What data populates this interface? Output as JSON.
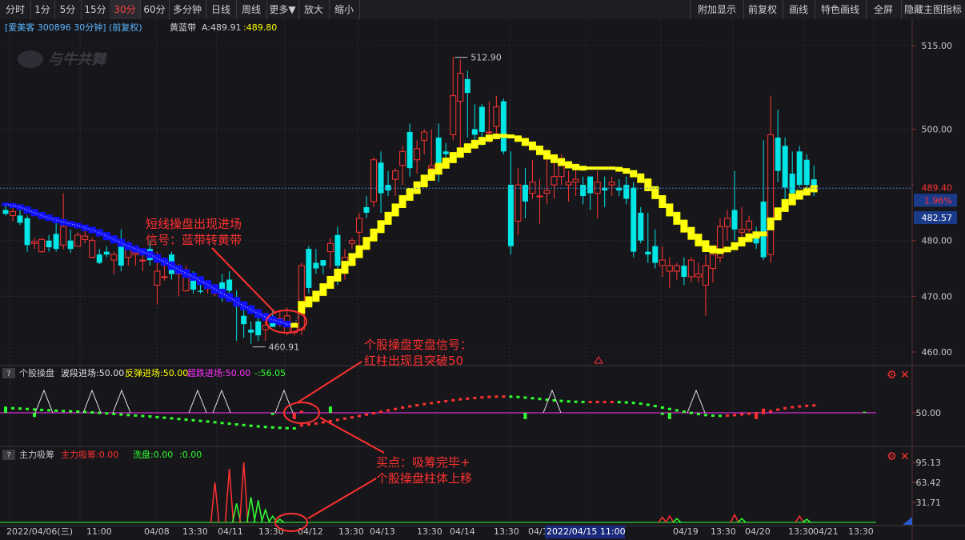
{
  "toolbar": {
    "left_buttons": [
      "分时",
      "1分",
      "5分",
      "15分",
      "30分",
      "60分",
      "多分钟",
      "日线",
      "周线",
      "更多▼",
      "放大",
      "缩小"
    ],
    "active": "30分",
    "right_buttons": [
      "附加显示",
      "前复权",
      "画线",
      "特色画线",
      "全屏",
      "隐藏主图指标"
    ]
  },
  "header": {
    "stock": "[爱美客 300896 30分钟] (前复权)",
    "indicator_name": "黄蓝带",
    "indicator_a_label": "A:489.91",
    "indicator_b_value": "489.80"
  },
  "watermark": "与牛共舞",
  "price_axis": {
    "ticks": [
      "515.00",
      "500.00",
      "490.00",
      "480.00",
      "470.00",
      "460.00"
    ],
    "last_price": "489.40",
    "change_pct": "1.96%",
    "blue_band_value": "482.57",
    "high_marker": "512.90",
    "low_marker": "460.91"
  },
  "panel2": {
    "title": "个股操盘",
    "items": [
      {
        "label": "波段进场:50.00",
        "color": "#e0e0e0"
      },
      {
        "label": "反弹进场:50.00",
        "color": "#ffff00"
      },
      {
        "label": "超跌进场:50.00",
        "color": "#ff30ff"
      },
      {
        "label": "-:56.05",
        "color": "#30ff30"
      }
    ],
    "axis_label": "50.00"
  },
  "panel3": {
    "title": "主力吸筹",
    "items": [
      {
        "label": "主力吸筹:0.00",
        "color": "#ff3030"
      },
      {
        "label": "洗盘:0.00",
        "color": "#30ff30"
      },
      {
        "label": ":0.00",
        "color": "#30ff30"
      }
    ],
    "axis_labels": [
      "95.13",
      "63.42",
      "31.71"
    ]
  },
  "time_axis": {
    "labels": [
      "2022/04/06(三)",
      "11:00",
      "04/08",
      "13:30",
      "04/11",
      "13:30",
      "04/12",
      "13:30",
      "04/13",
      "13:30",
      "04/14",
      "13:30",
      "04/1",
      "13:30",
      "04/19",
      "13:30",
      "04/20",
      "13:30",
      "04/21",
      "13:30"
    ],
    "cursor_label": "2022/04/15 11:00"
  },
  "annotations": {
    "a1_line1": "短线操盘出现进场",
    "a1_line2": "信号：蓝带转黄带",
    "a2_line1": "个股操盘变盘信号：",
    "a2_line2": "红柱出现且突破50",
    "a3_line1": "买点：吸筹完毕+",
    "a3_line2": "个股操盘柱体上移"
  },
  "chart_data": {
    "type": "candlestick",
    "title": "爱美客 300896 30分钟",
    "ylim": [
      458,
      517
    ],
    "candles_ohlc": [
      [
        485.5,
        486.5,
        484.5,
        484.8
      ],
      [
        484.5,
        486.5,
        483.5,
        485.2
      ],
      [
        484.5,
        485.5,
        482.8,
        483.2
      ],
      [
        484.0,
        484.5,
        478.0,
        479.2
      ],
      [
        479.5,
        480.5,
        478.5,
        479.8
      ],
      [
        478.0,
        480.5,
        477.8,
        480.2
      ],
      [
        480.0,
        481.0,
        478.0,
        478.8
      ],
      [
        481.2,
        483.5,
        478.0,
        478.5
      ],
      [
        479.2,
        488.5,
        478.5,
        482.5
      ],
      [
        480.0,
        482.0,
        477.8,
        478.5
      ],
      [
        479.0,
        481.5,
        479.0,
        481.0
      ],
      [
        480.2,
        481.8,
        479.5,
        480.8
      ],
      [
        477.0,
        480.5,
        476.8,
        480.0
      ],
      [
        477.5,
        478.5,
        475.8,
        476.0
      ],
      [
        478.0,
        479.0,
        477.0,
        477.5
      ],
      [
        476.5,
        478.0,
        474.0,
        477.5
      ],
      [
        479.5,
        482.0,
        474.5,
        475.5
      ],
      [
        477.0,
        479.5,
        475.5,
        479.0
      ],
      [
        477.5,
        479.0,
        475.5,
        477.8
      ],
      [
        476.5,
        478.5,
        474.5,
        476.5
      ],
      [
        478.5,
        480.0,
        475.5,
        476.5
      ],
      [
        472.0,
        478.0,
        468.5,
        474.5
      ],
      [
        473.5,
        475.5,
        472.8,
        473.5
      ],
      [
        477.5,
        478.0,
        473.0,
        474.0
      ],
      [
        474.0,
        475.8,
        470.0,
        474.5
      ],
      [
        471.0,
        475.5,
        470.8,
        474.2
      ],
      [
        473.0,
        474.5,
        470.5,
        471.2
      ],
      [
        471.0,
        473.5,
        470.5,
        470.8
      ],
      [
        471.5,
        472.5,
        470.5,
        471.5
      ],
      [
        470.5,
        471.5,
        470.0,
        471.0
      ],
      [
        472.5,
        474.0,
        469.0,
        469.8
      ],
      [
        473.0,
        474.5,
        470.0,
        471.0
      ],
      [
        469.5,
        471.0,
        462.0,
        468.5
      ],
      [
        466.5,
        468.5,
        462.5,
        465.0
      ],
      [
        464.0,
        465.5,
        461.5,
        463.5
      ],
      [
        465.5,
        466.5,
        462.0,
        463.0
      ],
      [
        464.0,
        465.5,
        462.0,
        464.8
      ],
      [
        466.0,
        467.5,
        464.5,
        464.5
      ],
      [
        466.0,
        467.5,
        464.5,
        466.0
      ],
      [
        463.5,
        468.0,
        463.0,
        466.5
      ],
      [
        463.5,
        465.0,
        463.0,
        464.8
      ],
      [
        464.0,
        476.0,
        463.0,
        475.5
      ],
      [
        478.5,
        479.0,
        470.5,
        471.5
      ],
      [
        476.0,
        478.5,
        474.0,
        475.0
      ],
      [
        476.5,
        476.5,
        474.0,
        475.5
      ],
      [
        478.0,
        480.5,
        475.0,
        479.5
      ],
      [
        481.0,
        482.5,
        472.0,
        475.5
      ],
      [
        476.0,
        478.5,
        473.0,
        477.0
      ],
      [
        479.5,
        480.5,
        478.5,
        480.0
      ],
      [
        481.5,
        485.0,
        478.0,
        484.0
      ],
      [
        486.0,
        488.0,
        484.0,
        485.0
      ],
      [
        487.0,
        495.0,
        486.0,
        494.5
      ],
      [
        494.0,
        496.0,
        485.0,
        488.5
      ],
      [
        490.0,
        492.5,
        488.0,
        489.0
      ],
      [
        491.0,
        493.0,
        488.0,
        492.5
      ],
      [
        493.5,
        497.0,
        490.0,
        496.0
      ],
      [
        499.5,
        501.0,
        491.5,
        493.0
      ],
      [
        494.5,
        498.0,
        492.0,
        496.5
      ],
      [
        498.0,
        500.0,
        495.5,
        499.5
      ],
      [
        493.0,
        500.0,
        491.5,
        493.5
      ],
      [
        498.5,
        501.0,
        490.5,
        493.5
      ],
      [
        496.0,
        497.5,
        494.5,
        495.5
      ],
      [
        499.0,
        513.0,
        498.0,
        506.0
      ],
      [
        505.0,
        512.5,
        496.5,
        510.0
      ],
      [
        509.0,
        510.5,
        498.5,
        506.5
      ],
      [
        500.0,
        504.5,
        497.0,
        499.0
      ],
      [
        504.0,
        504.5,
        497.0,
        499.5
      ],
      [
        499.5,
        505.0,
        497.5,
        499.5
      ],
      [
        500.5,
        506.0,
        498.5,
        504.0
      ],
      [
        505.0,
        505.5,
        495.5,
        496.0
      ],
      [
        490.0,
        496.0,
        477.5,
        479.0
      ],
      [
        483.5,
        493.0,
        481.0,
        490.0
      ],
      [
        490.0,
        493.0,
        484.0,
        487.0
      ],
      [
        488.5,
        494.5,
        487.5,
        490.5
      ],
      [
        488.0,
        491.0,
        483.0,
        488.0
      ],
      [
        488.5,
        496.0,
        486.5,
        489.0
      ],
      [
        490.0,
        495.5,
        487.5,
        491.5
      ],
      [
        491.5,
        495.5,
        490.0,
        494.0
      ],
      [
        490.0,
        492.5,
        487.0,
        490.5
      ],
      [
        490.5,
        493.0,
        488.0,
        491.0
      ],
      [
        490.0,
        491.5,
        486.5,
        488.0
      ],
      [
        491.5,
        491.5,
        485.5,
        488.5
      ],
      [
        488.5,
        492.5,
        484.0,
        490.5
      ],
      [
        489.5,
        491.5,
        486.0,
        489.0
      ],
      [
        490.0,
        491.5,
        488.0,
        490.5
      ],
      [
        489.5,
        491.0,
        488.0,
        489.0
      ],
      [
        490.0,
        491.5,
        486.5,
        487.5
      ],
      [
        489.5,
        490.5,
        477.0,
        478.0
      ],
      [
        485.0,
        486.0,
        479.5,
        480.0
      ],
      [
        478.0,
        485.0,
        476.0,
        477.5
      ],
      [
        479.0,
        482.0,
        475.0,
        476.0
      ],
      [
        475.5,
        479.0,
        473.5,
        476.5
      ],
      [
        474.5,
        477.0,
        471.5,
        475.5
      ],
      [
        474.5,
        476.0,
        473.0,
        475.5
      ],
      [
        475.5,
        477.0,
        472.0,
        473.5
      ],
      [
        473.5,
        477.0,
        472.5,
        476.5
      ],
      [
        473.5,
        476.0,
        472.5,
        474.0
      ],
      [
        472.0,
        477.5,
        466.5,
        475.5
      ],
      [
        475.0,
        478.0,
        472.5,
        477.5
      ],
      [
        477.0,
        484.0,
        476.0,
        482.5
      ],
      [
        482.5,
        485.5,
        480.0,
        484.0
      ],
      [
        485.5,
        492.5,
        480.0,
        482.0
      ],
      [
        481.5,
        486.0,
        480.5,
        482.0
      ],
      [
        482.0,
        484.5,
        481.5,
        483.5
      ],
      [
        481.0,
        482.5,
        478.5,
        479.5
      ],
      [
        487.0,
        498.0,
        476.5,
        477.0
      ],
      [
        477.5,
        506.0,
        476.0,
        499.0
      ],
      [
        498.5,
        503.5,
        490.5,
        492.5
      ],
      [
        497.0,
        498.5,
        486.5,
        489.5
      ],
      [
        492.0,
        496.0,
        488.0,
        488.5
      ],
      [
        496.0,
        497.0,
        489.5,
        490.0
      ],
      [
        494.5,
        495.5,
        489.0,
        490.0
      ],
      [
        491.0,
        493.5,
        488.0,
        489.4
      ]
    ],
    "band_values": [
      486.5,
      486.3,
      486.0,
      485.5,
      485.0,
      484.5,
      484.1,
      483.7,
      483.3,
      483.0,
      482.7,
      482.3,
      481.9,
      481.4,
      480.8,
      480.2,
      479.6,
      479.0,
      478.5,
      478.0,
      477.5,
      476.8,
      476.2,
      475.5,
      474.8,
      474.1,
      473.5,
      472.8,
      472.1,
      471.3,
      470.5,
      469.8,
      469.0,
      468.3,
      467.6,
      466.9,
      466.3,
      465.8,
      465.4,
      465.0,
      464.8,
      468.0,
      469.0,
      470.0,
      471.2,
      472.5,
      473.8,
      475.2,
      476.6,
      478.0,
      479.5,
      481.0,
      482.5,
      484.0,
      485.5,
      487.0,
      488.3,
      489.5,
      490.7,
      491.8,
      492.9,
      493.9,
      494.9,
      495.8,
      496.6,
      497.3,
      497.9,
      498.4,
      498.7,
      498.8,
      498.7,
      498.3,
      497.7,
      497.0,
      496.2,
      495.4,
      494.7,
      494.1,
      493.6,
      493.2,
      493.0,
      493.0,
      493.0,
      493.0,
      493.0,
      492.8,
      492.5,
      492.0,
      491.2,
      490.0,
      488.6,
      487.0,
      485.5,
      484.0,
      482.6,
      481.3,
      480.1,
      479.0,
      478.4,
      478.1,
      478.4,
      479.0,
      479.8,
      480.5,
      481.0,
      481.2,
      483.0,
      484.8,
      486.3,
      487.4,
      488.2,
      488.8,
      489.3
    ],
    "band_turn_index": 40,
    "last_price": 489.4,
    "change_pct": "1.96%",
    "high": 512.9,
    "low": 460.91,
    "panel2_series": [
      {
        "name": "波段进场",
        "values_ref": 50
      },
      {
        "name": "-",
        "last_value": 56.05
      }
    ],
    "panel3_series": [
      {
        "name": "主力吸筹",
        "peaks": [
          95.13,
          63.42
        ]
      },
      {
        "name": "洗盘",
        "last_value": 0.0
      }
    ]
  }
}
